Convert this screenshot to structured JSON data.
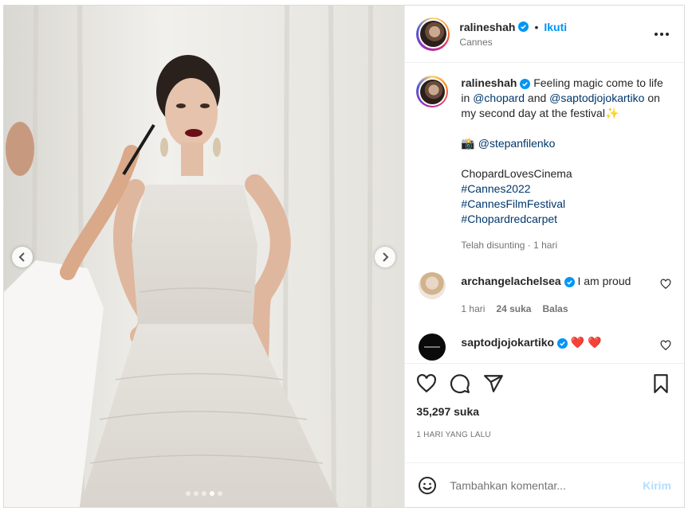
{
  "post": {
    "author": {
      "username": "ralineshah",
      "location": "Cannes",
      "follow_label": "Ikuti",
      "verified": true
    },
    "caption": {
      "username": "ralineshah",
      "text_1": "Feeling magic come to life in",
      "mention_1": "@chopard",
      "and": "and",
      "mention_2": "@saptodjojokartiko",
      "text_2": "on my second day at the festival",
      "sparkle": "✨",
      "camera": "📸",
      "mention_3": "@stepanfilenko",
      "plain_tag": "ChopardLovesCinema",
      "hashtags": [
        "#Cannes2022",
        "#CannesFilmFestival",
        "#Chopardredcarpet"
      ],
      "meta": "Telah disunting · 1 hari"
    },
    "comments": [
      {
        "username": "archangelachelsea",
        "text": "I am proud",
        "time": "1 hari",
        "likes": "24 suka",
        "reply": "Balas"
      },
      {
        "username": "saptodjojokartiko",
        "text": "❤️ ❤️"
      }
    ],
    "likes": "35,297 suka",
    "posted": "1 hari yang lalu",
    "comment_input": {
      "placeholder": "Tambahkan komentar..."
    },
    "post_button": "Kirim",
    "carousel": {
      "total": 5,
      "active_index": 3
    }
  },
  "icons": {
    "more": "more-horizontal-icon",
    "like": "heart-icon",
    "comment": "comment-icon",
    "share": "paper-plane-icon",
    "save": "bookmark-icon",
    "emoji": "smiley-icon",
    "prev": "chevron-left-icon",
    "next": "chevron-right-icon"
  },
  "colors": {
    "link": "#00376b",
    "follow": "#0095f6",
    "verified": "#0095f6",
    "muted": "#737373",
    "post_disabled": "#b2dffc"
  }
}
